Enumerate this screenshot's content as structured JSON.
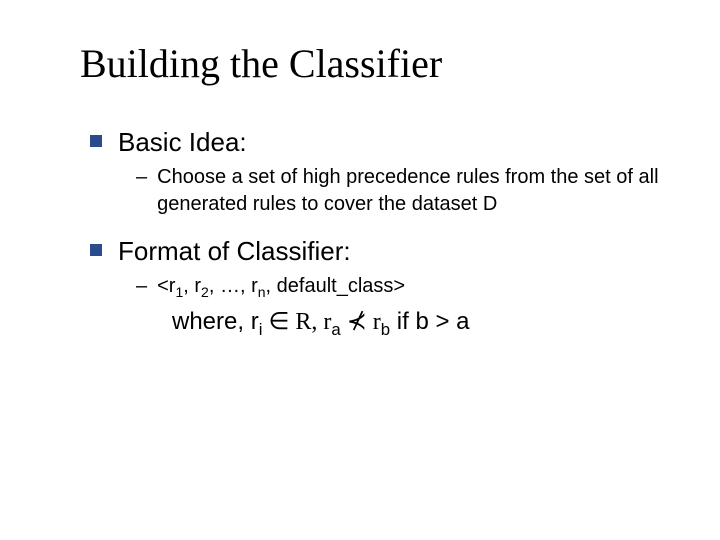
{
  "slide": {
    "title": "Building the Classifier",
    "bullet1": {
      "label": "Basic Idea:",
      "sub1": "Choose a set of high precedence rules from the set of all generated rules to cover the dataset D"
    },
    "bullet2": {
      "label": "Format of Classifier:",
      "sub1_prefix": "<r",
      "sub1_s1": "1",
      "sub1_mid1": ", r",
      "sub1_s2": "2",
      "sub1_mid2": ", …, r",
      "sub1_sn": "n",
      "sub1_suffix": ", default_class>",
      "line2_prefix": "where, r",
      "line2_si": "i",
      "line2_in": " ∈ R, r",
      "line2_sa": "a",
      "line2_prec": " ⊀ r",
      "line2_sb": "b",
      "line2_cond": " if b > a"
    }
  }
}
